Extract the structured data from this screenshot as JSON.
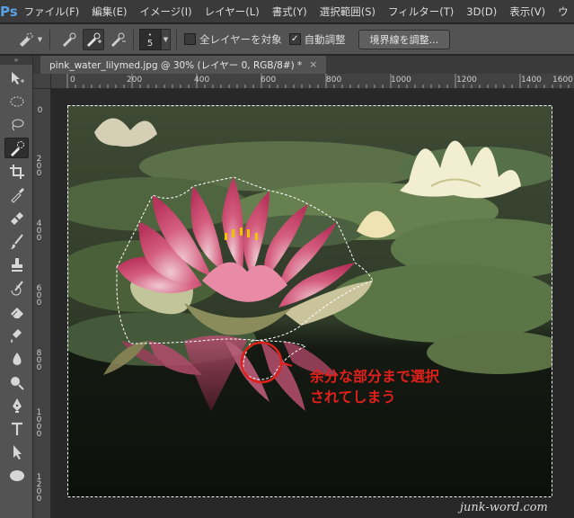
{
  "app": {
    "logo": "Ps"
  },
  "menu": [
    "ファイル(F)",
    "編集(E)",
    "イメージ(I)",
    "レイヤー(L)",
    "書式(Y)",
    "選択範囲(S)",
    "フィルター(T)",
    "3D(D)",
    "表示(V)",
    "ウ"
  ],
  "options": {
    "brush_size": "5",
    "sample_all_layers": "全レイヤーを対象",
    "sample_all_layers_checked": false,
    "auto_enhance": "自動調整",
    "auto_enhance_checked": true,
    "refine_edge_button": "境界線を調整..."
  },
  "document_tab": {
    "title": "pink_water_lilymed.jpg @ 30% (レイヤー 0, RGB/8#) *",
    "close": "×"
  },
  "ruler": {
    "top_labels": [
      "0",
      "200",
      "400",
      "600",
      "800",
      "1000",
      "1200",
      "1400",
      "1600"
    ],
    "left_labels": [
      "0",
      "200",
      "400",
      "600",
      "800",
      "1000",
      "1200"
    ]
  },
  "annotation": {
    "line1": "余分な部分まで選択",
    "line2": "されてしまう",
    "color": "#e0211b"
  },
  "watermark": "junk-word.com",
  "tools": [
    "move-tool",
    "marquee-tool",
    "lasso-tool",
    "quick-selection-tool",
    "crop-tool",
    "eyedropper-tool",
    "healing-brush-tool",
    "brush-tool",
    "clone-stamp-tool",
    "history-brush-tool",
    "eraser-tool",
    "gradient-tool",
    "blur-tool",
    "dodge-tool",
    "pen-tool",
    "type-tool",
    "path-selection-tool",
    "shape-tool"
  ]
}
